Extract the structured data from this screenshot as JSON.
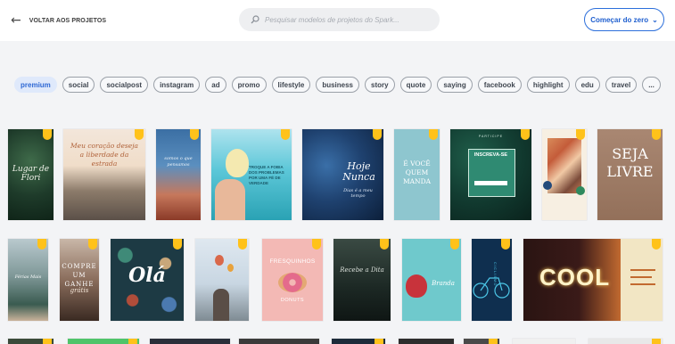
{
  "header": {
    "back_label": "VOLTAR AOS PROJETOS",
    "back_icon": "arrow-left-icon",
    "search_placeholder": "Pesquisar modelos de projetos do Spark...",
    "search_icon": "search-icon",
    "start_button_label": "Começar do zero",
    "start_button_icon": "chevron-down-icon"
  },
  "tags": [
    "premium",
    "social",
    "socialpost",
    "instagram",
    "ad",
    "promo",
    "lifestyle",
    "business",
    "story",
    "quote",
    "saying",
    "facebook",
    "highlight",
    "edu",
    "travel",
    "..."
  ],
  "active_tag": "premium",
  "colors": {
    "accent": "#2c6fdb",
    "premium_badge": "#ffc21a",
    "active_tag_bg": "#dfe9fb",
    "page_bg": "#f3f4f6"
  },
  "cards": {
    "c1": "Lugar de Flori",
    "c2": "Meu coração deseja a liberdade da estrada",
    "c3": "somos o que pensamos",
    "c4": "TROQUE A FOBIA DOS PROBLEMAS POR UMA FÉ DE VERDADE",
    "c5_title": "Hoje Nunca",
    "c5_sub": "Dias é a meu tempo",
    "c6": "É VOCÊ QUEM MANDA",
    "c7_top": "PARTICIPE",
    "c7_main": "INSCREVA-SE",
    "c9": "SEJA LIVRE",
    "c10": "Férias Mais",
    "c11_main": "COMPRE UM GANHE",
    "c11_sub": "grátis",
    "c12": "Olá",
    "c14_title": "FRESQUINHOS",
    "c14_sub": "DONUTS",
    "c15": "Recebe a Dita",
    "c16": "Branda",
    "c17": "CICLISMO",
    "c18": "COOL"
  }
}
